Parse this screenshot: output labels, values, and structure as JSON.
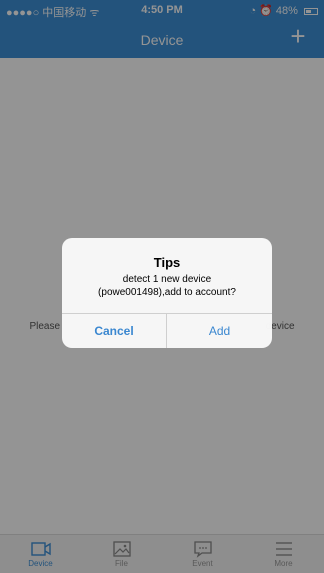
{
  "status_bar": {
    "carrier": "●●●●○ 中国移动 ᯤ",
    "time": "4:50 PM",
    "battery": "48%"
  },
  "nav": {
    "title": "Device",
    "add_icon": "plus-icon"
  },
  "content": {
    "empty_left": "Please",
    "empty_right": "device"
  },
  "dialog": {
    "title": "Tips",
    "message_line1": "detect 1 new device",
    "message_line2": "(powe001498),add to account?",
    "cancel_label": "Cancel",
    "add_label": "Add"
  },
  "tabs": [
    {
      "label": "Device",
      "icon": "camera-icon",
      "active": true
    },
    {
      "label": "File",
      "icon": "image-icon",
      "active": false
    },
    {
      "label": "Event",
      "icon": "message-icon",
      "active": false
    },
    {
      "label": "More",
      "icon": "menu-icon",
      "active": false
    }
  ],
  "colors": {
    "header": "#3d8fd6",
    "accent": "#3a87d0",
    "tab_inactive": "#999999"
  }
}
